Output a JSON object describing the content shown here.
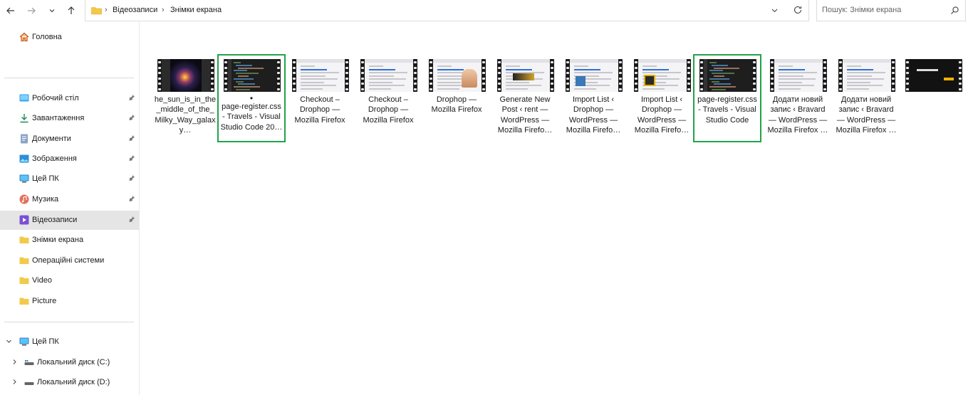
{
  "nav": {
    "back_icon": "arrow-left-icon",
    "forward_icon": "arrow-right-icon",
    "recent_icon": "chevron-down-icon",
    "up_icon": "arrow-up-icon"
  },
  "address": {
    "crumbs": [
      "Відеозаписи",
      "Знімки екрана"
    ]
  },
  "search": {
    "placeholder": "Пошук: Знімки екрана"
  },
  "sidebar": {
    "home": "Головна",
    "quick": [
      {
        "label": "Робочий стіл",
        "icon": "desktop-icon",
        "pinned": true
      },
      {
        "label": "Завантаження",
        "icon": "download-icon",
        "pinned": true
      },
      {
        "label": "Документи",
        "icon": "documents-icon",
        "pinned": true
      },
      {
        "label": "Зображення",
        "icon": "pictures-icon",
        "pinned": true
      },
      {
        "label": "Цей ПК",
        "icon": "this-pc-icon",
        "pinned": true
      },
      {
        "label": "Музика",
        "icon": "music-icon",
        "pinned": true
      },
      {
        "label": "Відеозаписи",
        "icon": "videos-icon",
        "pinned": true,
        "selected": true
      },
      {
        "label": "Знімки екрана",
        "icon": "folder-icon",
        "pinned": false
      },
      {
        "label": "Операційні системи",
        "icon": "folder-icon",
        "pinned": false
      },
      {
        "label": "Video",
        "icon": "folder-icon",
        "pinned": false
      },
      {
        "label": "Picture",
        "icon": "folder-icon",
        "pinned": false
      }
    ],
    "tree": [
      {
        "label": "Цей ПК",
        "icon": "this-pc-icon"
      },
      {
        "label": "Локальний диск (C:)",
        "icon": "drive-icon"
      },
      {
        "label": "Локальний диск (D:)",
        "icon": "drive-icon"
      }
    ]
  },
  "files": [
    {
      "name": "he_sun_is_in_the_middle_of_the_Milky_Way_galaxy…",
      "thumb": "galaxy",
      "selected": false,
      "dot": false
    },
    {
      "name": "page-register.css - Travels - Visual Studio Code 20…",
      "thumb": "code",
      "selected": true,
      "dot": true
    },
    {
      "name": "Checkout – Drophop — Mozilla Firefox",
      "thumb": "web",
      "selected": false,
      "dot": false
    },
    {
      "name": "Checkout – Drophop — Mozilla Firefox",
      "thumb": "web",
      "selected": false,
      "dot": false
    },
    {
      "name": "Drophop — Mozilla Firefox",
      "thumb": "web-photo",
      "selected": false,
      "dot": false
    },
    {
      "name": "Generate New Post ‹ rent — WordPress — Mozilla Firefo…",
      "thumb": "web-banner",
      "selected": false,
      "dot": false
    },
    {
      "name": "Import List ‹ Drophop — WordPress — Mozilla Firefo…",
      "thumb": "web-list",
      "selected": false,
      "dot": false
    },
    {
      "name": "Import List ‹ Drophop — WordPress — Mozilla Firefo…",
      "thumb": "web-list2",
      "selected": false,
      "dot": false
    },
    {
      "name": "page-register.css - Travels - Visual Studio Code",
      "thumb": "code",
      "selected": true,
      "dot": false
    },
    {
      "name": "Додати новий запис ‹ Bravard — WordPress — Mozilla Firefox …",
      "thumb": "web",
      "selected": false,
      "dot": false
    },
    {
      "name": "Додати новий запис ‹ Bravard — WordPress — Mozilla Firefox …",
      "thumb": "web",
      "selected": false,
      "dot": false
    },
    {
      "name": "",
      "thumb": "dark",
      "selected": false,
      "dot": false
    }
  ],
  "colors": {
    "selection_border": "#22a34a",
    "sidebar_selected": "#e5e5e5"
  }
}
